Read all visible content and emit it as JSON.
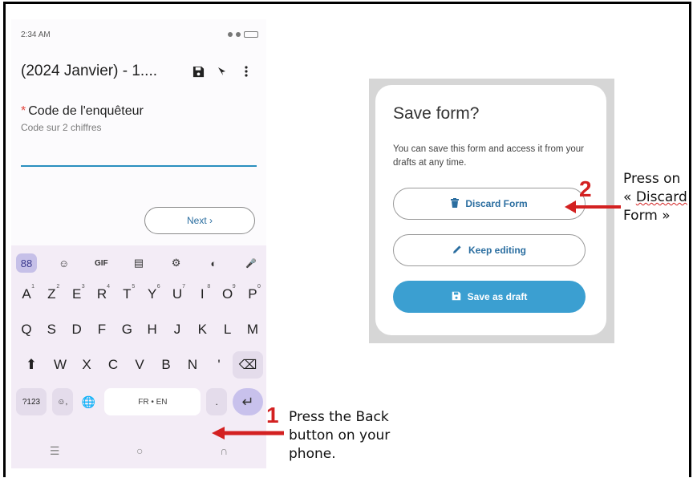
{
  "phone": {
    "status": {
      "time": "2:34 AM"
    },
    "appbar": {
      "title": "(2024 Janvier) - 1....",
      "save_icon": "save-icon",
      "pin_icon": "pin-icon",
      "menu_icon": "more-vert-icon"
    },
    "question": {
      "required_mark": "*",
      "label": "Code de l'enquêteur",
      "hint": "Code sur 2 chiffres"
    },
    "next_button": "Next ›",
    "keyboard": {
      "toolbar": [
        "88",
        "☺",
        "GIF",
        "▤",
        "⚙",
        "◐",
        "🎤"
      ],
      "row1": [
        {
          "k": "A",
          "s": "1"
        },
        {
          "k": "Z",
          "s": "2"
        },
        {
          "k": "E",
          "s": "3"
        },
        {
          "k": "R",
          "s": "4"
        },
        {
          "k": "T",
          "s": "5"
        },
        {
          "k": "Y",
          "s": "6"
        },
        {
          "k": "U",
          "s": "7"
        },
        {
          "k": "I",
          "s": "8"
        },
        {
          "k": "O",
          "s": "9"
        },
        {
          "k": "P",
          "s": "0"
        }
      ],
      "row2": [
        "Q",
        "S",
        "D",
        "F",
        "G",
        "H",
        "J",
        "K",
        "L",
        "M"
      ],
      "row3": [
        "W",
        "X",
        "C",
        "V",
        "B",
        "N",
        "'"
      ],
      "shift": "⬆",
      "backspace": "⌫",
      "symbols": "?123",
      "emoji_comma": "☺,",
      "globe": "🌐",
      "space": "FR • EN",
      "period": ".",
      "enter": "↵",
      "nav": [
        "☰",
        "○",
        "∩"
      ]
    }
  },
  "dialog": {
    "title": "Save form?",
    "body": "You can save this form and access it from your drafts at any time.",
    "discard": "Discard Form",
    "keep": "Keep editing",
    "save": "Save as draft"
  },
  "annotations": {
    "step1_num": "1",
    "step1_text": [
      "Press the Back",
      "button on your",
      "phone."
    ],
    "step2_num": "2",
    "step2_line1": "Press on",
    "step2_line2_prefix": "« ",
    "step2_line2_word": "Discard",
    "step2_line3": "Form »"
  },
  "colors": {
    "accent": "#3b9fd1",
    "annotation_red": "#d32121",
    "required": "#e2443c"
  }
}
